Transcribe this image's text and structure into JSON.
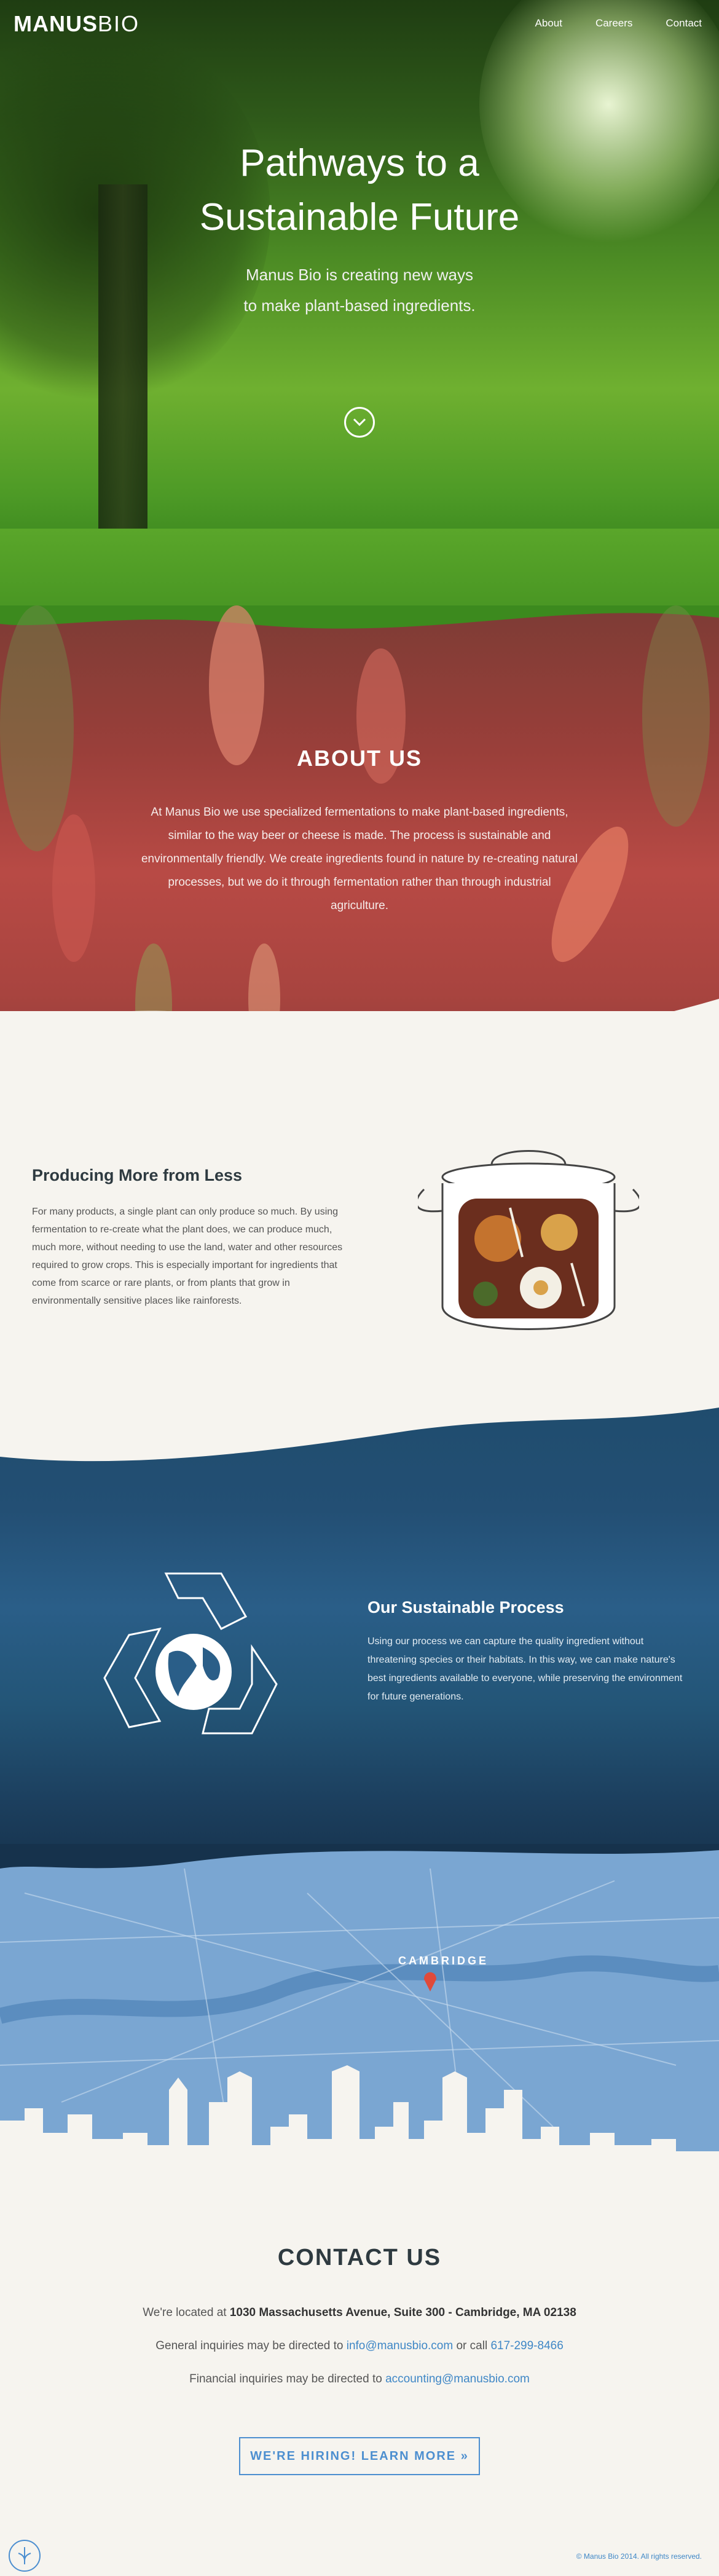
{
  "nav": {
    "logo_bold": "MANUS",
    "logo_light": "BIO",
    "links": [
      "About",
      "Careers",
      "Contact"
    ]
  },
  "hero": {
    "title_line1": "Pathways to a",
    "title_line2": "Sustainable Future",
    "subtitle_line1": "Manus Bio is creating new ways",
    "subtitle_line2": "to make plant-based ingredients."
  },
  "about": {
    "heading": "ABOUT US",
    "body": "At Manus Bio we use specialized fermentations to make plant-based ingredients, similar to the way beer or cheese is made. The process is sustainable and environmentally friendly. We create ingredients found in nature by re-creating natural processes, but we do it through fermentation rather than through industrial agriculture."
  },
  "producing": {
    "heading": "Producing More from Less",
    "body": "For many products, a single plant can only produce so much. By using fermentation to re-create what the plant does, we can produce much, much more, without needing to use the land, water and other resources required to grow crops. This is especially important for ingredients that come from scarce or rare plants, or from plants that grow in environmentally sensitive places like rainforests."
  },
  "sustainable": {
    "heading": "Our Sustainable Process",
    "body": "Using our process we can capture the quality ingredient without threatening species or their habitats. In this way, we can make nature's best ingredients available to everyone, while preserving the environment for future generations."
  },
  "map": {
    "label": "CAMBRIDGE"
  },
  "contact": {
    "heading": "CONTACT US",
    "location_prefix": "We're located at",
    "address": "1030 Massachusetts Avenue, Suite 300 - Cambridge, MA 02138",
    "general_prefix": "General inquiries may be directed to",
    "general_email": "info@manusbio.com",
    "general_or": "or call",
    "phone": "617-299-8466",
    "financial_prefix": "Financial inquiries may be directed to",
    "financial_email": "accounting@manusbio.com",
    "hiring_button": "WE'RE HIRING! LEARN MORE »"
  },
  "footer": {
    "copyright": "© Manus Bio 2014. All rights reserved."
  },
  "colors": {
    "accent": "#4d8fd0",
    "heading": "#2e3a40",
    "link": "#3f87c6"
  }
}
